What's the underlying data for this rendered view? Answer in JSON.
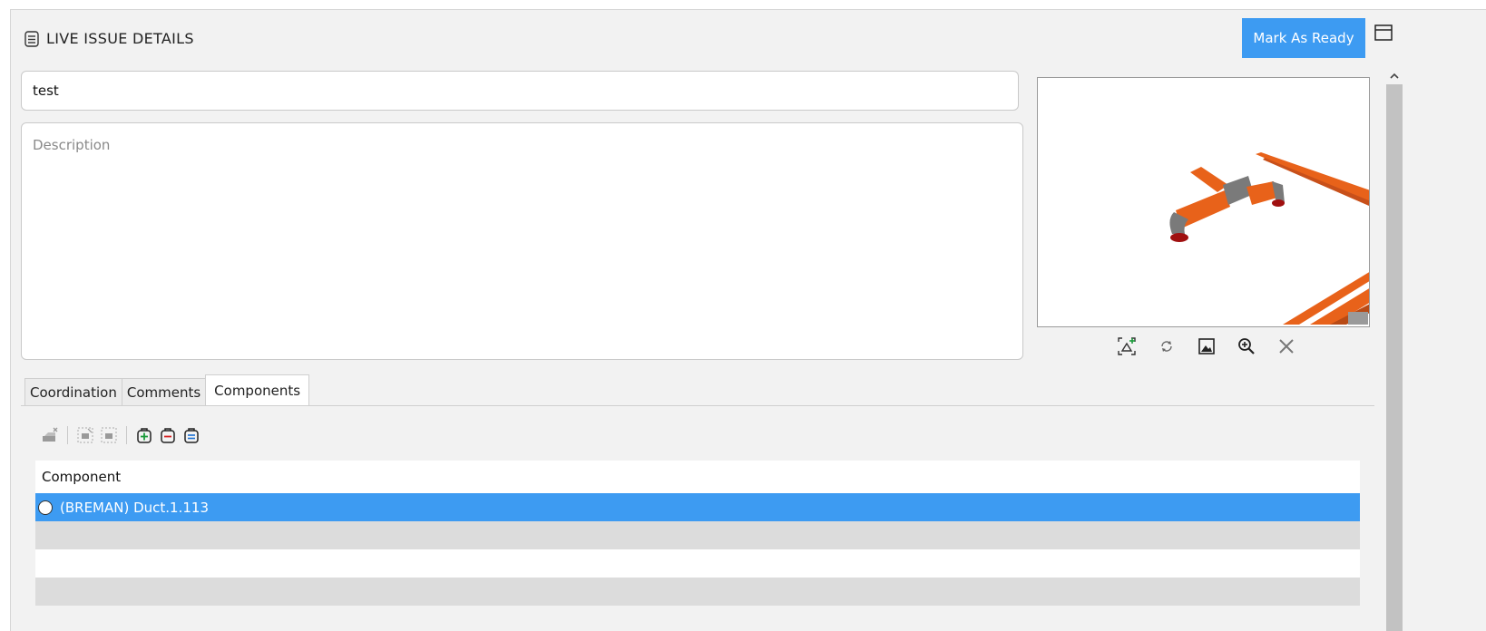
{
  "header": {
    "title": "LIVE ISSUE DETAILS",
    "icon": "issue-list-icon",
    "mark_ready_label": "Mark As Ready"
  },
  "form": {
    "title_value": "test",
    "description_placeholder": "Description",
    "description_value": ""
  },
  "preview": {
    "tools": [
      "capture-viewpoint-icon",
      "refresh-icon",
      "image-icon",
      "zoom-in-icon",
      "close-icon"
    ]
  },
  "tabs": [
    {
      "label": "Coordination",
      "active": false
    },
    {
      "label": "Comments",
      "active": false
    },
    {
      "label": "Components",
      "active": true
    }
  ],
  "components": {
    "column_header": "Component",
    "rows": [
      {
        "label": "(BREMAN) Duct.1.113",
        "selected": true
      }
    ]
  },
  "colors": {
    "accent": "#3d9bf2",
    "duct_orange": "#e8621a",
    "fitting_gray": "#7a7a7a"
  }
}
